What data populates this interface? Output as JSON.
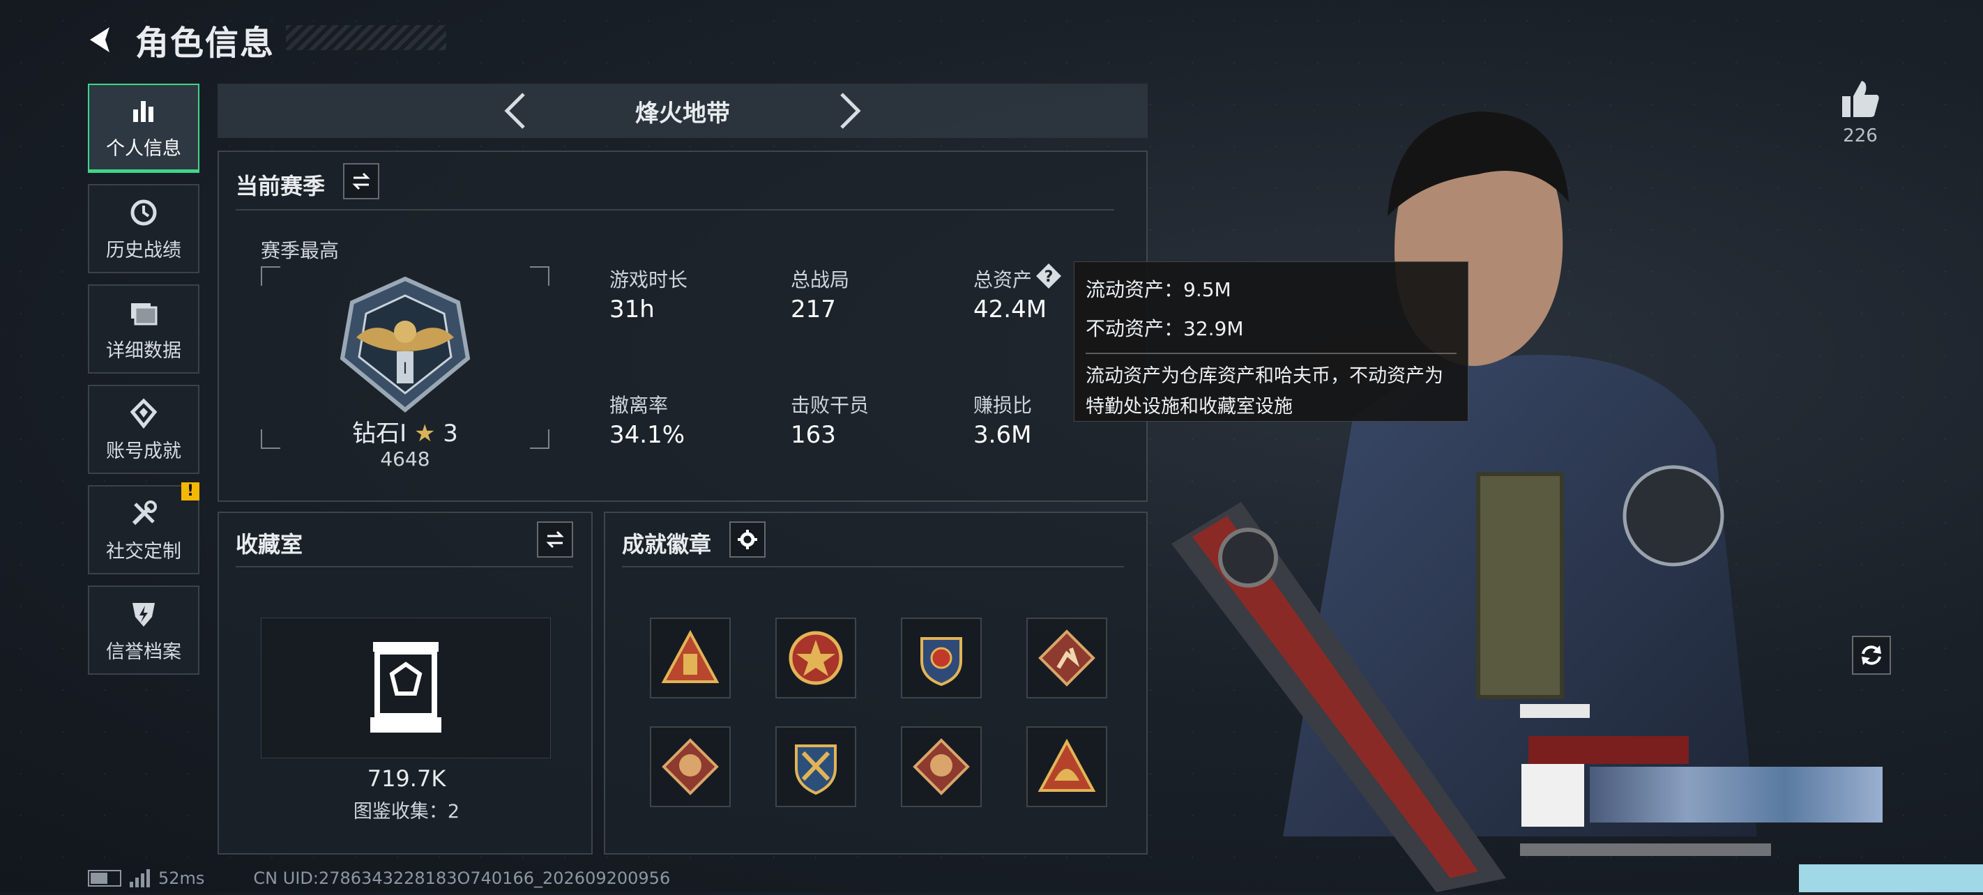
{
  "header": {
    "title": "角色信息"
  },
  "sidenav": {
    "items": [
      {
        "label": "个人信息",
        "icon": "bar-chart-icon",
        "active": true
      },
      {
        "label": "历史战绩",
        "icon": "history-clock-icon",
        "active": false
      },
      {
        "label": "详细数据",
        "icon": "folder-stack-icon",
        "active": false
      },
      {
        "label": "账号成就",
        "icon": "achievement-emblem-icon",
        "active": false
      },
      {
        "label": "社交定制",
        "icon": "wrench-tools-icon",
        "active": false,
        "badge": "!"
      },
      {
        "label": "信誉档案",
        "icon": "shield-lightning-icon",
        "active": false
      }
    ]
  },
  "mode": {
    "name": "烽火地带"
  },
  "season": {
    "title": "当前赛季",
    "best_label": "赛季最高",
    "rank_name": "钻石Ⅰ",
    "rank_stars": "3",
    "rank_points": "4648",
    "stats": [
      {
        "label": "游戏时长",
        "value": "31h"
      },
      {
        "label": "总战局",
        "value": "217"
      },
      {
        "label": "总资产",
        "value": "42.4M"
      },
      {
        "label": "撤离率",
        "value": "34.1%"
      },
      {
        "label": "击败干员",
        "value": "163"
      },
      {
        "label": "赚损比",
        "value": "3.6M"
      }
    ]
  },
  "tooltip": {
    "liquid": "流动资产：9.5M",
    "fixed": "不动资产：32.9M",
    "description": "流动资产为仓库资产和哈夫币，不动资产为特勤处设施和收藏室设施"
  },
  "collection": {
    "title": "收藏室",
    "value": "719.7K",
    "count_label": "图鉴收集：2"
  },
  "badges": {
    "title": "成就徽章",
    "items": [
      "triangle-supply-badge",
      "star-medal-badge",
      "eagle-crest-badge",
      "runner-diamond-badge",
      "dragon-diamond-badge",
      "crossed-rifles-badge",
      "dragon-diamond-badge-2",
      "helmet-triangle-badge"
    ]
  },
  "likes": {
    "count": "226"
  },
  "footer": {
    "ping": "52ms",
    "uid": "CN UID:2786343228183O740166_202609200956"
  },
  "colors": {
    "accent": "#3fd68a",
    "warning": "#f5b800"
  }
}
